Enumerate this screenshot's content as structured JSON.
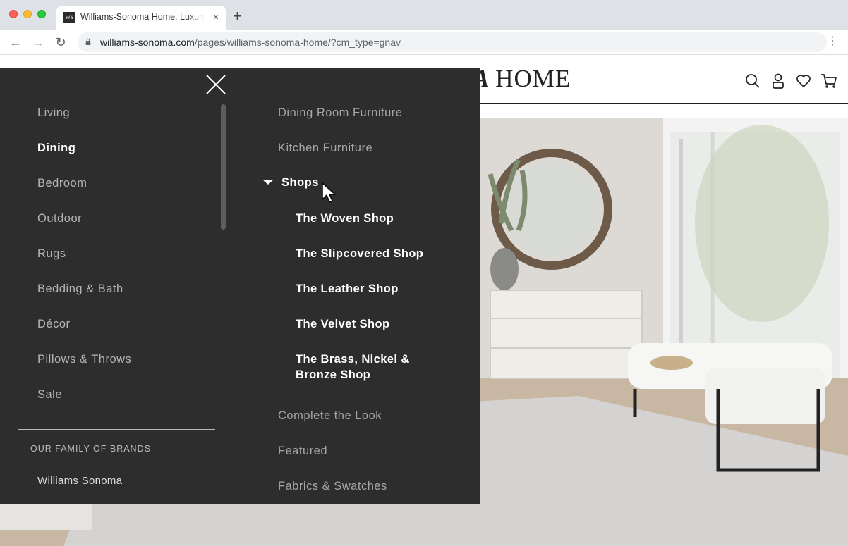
{
  "browser": {
    "tab_title": "Williams-Sonoma Home, Luxury",
    "favicon_text": "WS",
    "tab_close": "×",
    "new_tab": "+",
    "url_host": "williams-sonoma.com",
    "url_path": "/pages/williams-sonoma-home/?cm_type=gnav",
    "back_glyph": "←",
    "forward_glyph": "→",
    "reload_glyph": "↻",
    "menu_glyph": "⋮"
  },
  "site": {
    "logo_partial": "MA",
    "logo_word": " HOME",
    "icons": [
      "search-icon",
      "account-icon",
      "heart-icon",
      "cart-icon"
    ]
  },
  "menu": {
    "left_items": [
      {
        "label": "Living"
      },
      {
        "label": "Dining"
      },
      {
        "label": "Bedroom"
      },
      {
        "label": "Outdoor"
      },
      {
        "label": "Rugs"
      },
      {
        "label": "Bedding & Bath"
      },
      {
        "label": "Décor"
      },
      {
        "label": "Pillows & Throws"
      },
      {
        "label": "Sale"
      }
    ],
    "active_item": "Dining",
    "brands_heading": "OUR FAMILY OF BRANDS",
    "brands": [
      "Williams Sonoma"
    ],
    "right_items_top": [
      "Dining Room Furniture",
      "Kitchen Furniture"
    ],
    "shops_heading": "Shops",
    "shops": [
      "The Woven Shop",
      "The Slipcovered Shop",
      "The Leather Shop",
      "The Velvet Shop",
      "The Brass, Nickel &",
      "Bronze Shop"
    ],
    "right_items_bottom": [
      "Complete the Look",
      "Featured",
      "Fabrics & Swatches"
    ]
  },
  "colors": {
    "menu_bg": "#2d2d2d",
    "active_text": "#ffffff",
    "inactive_text": "#b4b4b4"
  }
}
